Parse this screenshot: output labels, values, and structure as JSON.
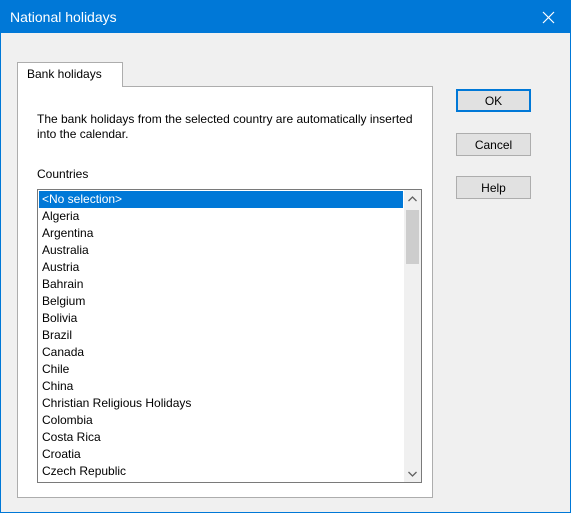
{
  "window": {
    "title": "National holidays"
  },
  "tabs": [
    {
      "label": "Bank holidays"
    }
  ],
  "panel": {
    "description": "The bank holidays from the selected country are automatically inserted into the calendar.",
    "countries_label": "Countries",
    "countries": [
      "<No selection>",
      "Algeria",
      "Argentina",
      "Australia",
      "Austria",
      "Bahrain",
      "Belgium",
      "Bolivia",
      "Brazil",
      "Canada",
      "Chile",
      "China",
      "Christian Religious Holidays",
      "Colombia",
      "Costa Rica",
      "Croatia",
      "Czech Republic"
    ],
    "selected_country": "<No selection>"
  },
  "buttons": {
    "ok_label": "OK",
    "cancel_label": "Cancel",
    "help_label": "Help"
  },
  "colors": {
    "titlebar": "#0078d7",
    "selection": "#0078d7",
    "window_bg": "#f0f0f0"
  },
  "icons": {
    "close": "close-icon",
    "scroll_up": "chevron-up-icon",
    "scroll_down": "chevron-down-icon"
  }
}
